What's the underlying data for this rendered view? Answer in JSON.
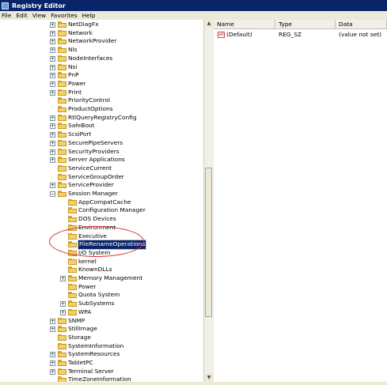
{
  "window": {
    "title": "Registry Editor"
  },
  "menu": [
    "File",
    "Edit",
    "View",
    "Favorites",
    "Help"
  ],
  "tree": [
    {
      "label": "NetDiagFx",
      "level": 0,
      "exp": true
    },
    {
      "label": "Network",
      "level": 0,
      "exp": true
    },
    {
      "label": "NetworkProvider",
      "level": 0,
      "exp": true
    },
    {
      "label": "Nls",
      "level": 0,
      "exp": true
    },
    {
      "label": "NodeInterfaces",
      "level": 0,
      "exp": true
    },
    {
      "label": "Nsi",
      "level": 0,
      "exp": true
    },
    {
      "label": "PnP",
      "level": 0,
      "exp": true
    },
    {
      "label": "Power",
      "level": 0,
      "exp": true
    },
    {
      "label": "Print",
      "level": 0,
      "exp": true
    },
    {
      "label": "PriorityControl",
      "level": 0,
      "exp": false
    },
    {
      "label": "ProductOptions",
      "level": 0,
      "exp": false
    },
    {
      "label": "RtlQueryRegistryConfig",
      "level": 0,
      "exp": true
    },
    {
      "label": "SafeBoot",
      "level": 0,
      "exp": true
    },
    {
      "label": "ScsiPort",
      "level": 0,
      "exp": true
    },
    {
      "label": "SecurePipeServers",
      "level": 0,
      "exp": true
    },
    {
      "label": "SecurityProviders",
      "level": 0,
      "exp": true
    },
    {
      "label": "Server Applications",
      "level": 0,
      "exp": true
    },
    {
      "label": "ServiceCurrent",
      "level": 0,
      "exp": false
    },
    {
      "label": "ServiceGroupOrder",
      "level": 0,
      "exp": false
    },
    {
      "label": "ServiceProvider",
      "level": 0,
      "exp": true
    },
    {
      "label": "Session Manager",
      "level": 0,
      "exp": "minus"
    },
    {
      "label": "AppCompatCache",
      "level": 1,
      "exp": false
    },
    {
      "label": "Configuration Manager",
      "level": 1,
      "exp": false
    },
    {
      "label": "DOS Devices",
      "level": 1,
      "exp": false
    },
    {
      "label": "Environment",
      "level": 1,
      "exp": false
    },
    {
      "label": "Executive",
      "level": 1,
      "exp": false
    },
    {
      "label": "FileRenameOperations",
      "level": 1,
      "exp": false,
      "selected": true
    },
    {
      "label": "I/O System",
      "level": 1,
      "exp": false
    },
    {
      "label": "kernel",
      "level": 1,
      "exp": false
    },
    {
      "label": "KnownDLLs",
      "level": 1,
      "exp": false
    },
    {
      "label": "Memory Management",
      "level": 1,
      "exp": true
    },
    {
      "label": "Power",
      "level": 1,
      "exp": false
    },
    {
      "label": "Quota System",
      "level": 1,
      "exp": false
    },
    {
      "label": "SubSystems",
      "level": 1,
      "exp": true
    },
    {
      "label": "WPA",
      "level": 1,
      "exp": true
    },
    {
      "label": "SNMP",
      "level": 0,
      "exp": true
    },
    {
      "label": "StillImage",
      "level": 0,
      "exp": true
    },
    {
      "label": "Storage",
      "level": 0,
      "exp": false
    },
    {
      "label": "SystemInformation",
      "level": 0,
      "exp": false
    },
    {
      "label": "SystemResources",
      "level": 0,
      "exp": true
    },
    {
      "label": "TabletPC",
      "level": 0,
      "exp": true
    },
    {
      "label": "Terminal Server",
      "level": 0,
      "exp": true
    },
    {
      "label": "TimeZoneInformation",
      "level": 0,
      "exp": false
    }
  ],
  "list": {
    "headers": [
      "Name",
      "Type",
      "Data"
    ],
    "rows": [
      {
        "name": "(Default)",
        "type": "REG_SZ",
        "data": "(value not set)"
      }
    ]
  },
  "colors": {
    "selection": "#0a246a",
    "titlebar": "#0a246a",
    "annotation": "#e02828"
  }
}
